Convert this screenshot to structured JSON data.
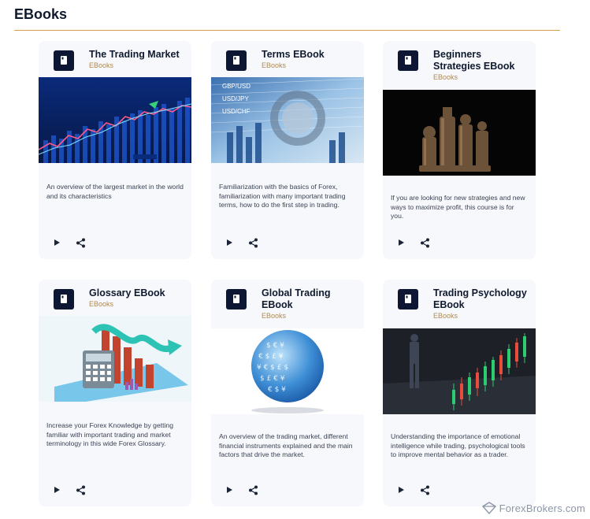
{
  "page": {
    "title": "EBooks"
  },
  "cards": [
    {
      "title": "The Trading Market",
      "category": "EBooks",
      "description": "An overview of the largest market in the world and its characteristics",
      "image": "rising-chart-image"
    },
    {
      "title": "Terms EBook",
      "category": "EBooks",
      "description": "Familiarization with the basics of Forex, familiarization with many important trading terms, how to do the first step in trading.",
      "image": "forex-terms-image"
    },
    {
      "title": "Beginners Strategies EBook",
      "category": "EBooks",
      "description": "If you are looking for new strategies and new ways to maximize profit, this course is for you.",
      "image": "chess-pieces-image"
    },
    {
      "title": "Glossary EBook",
      "category": "EBooks",
      "description": "Increase your Forex Knowledge by getting familiar with important trading and market terminology in this wide Forex Glossary.",
      "image": "calculator-chart-image"
    },
    {
      "title": "Global Trading EBook",
      "category": "EBooks",
      "description": "An overview of the trading market, different financial instruments explained and the main factors that drive the market.",
      "image": "currency-globe-image"
    },
    {
      "title": "Trading Psychology EBook",
      "category": "EBooks",
      "description": "Understanding the importance of emotional intelligence while trading, psychological tools to improve mental behavior as a trader.",
      "image": "trader-candles-image"
    }
  ],
  "watermark": {
    "text": "ForexBrokers.com"
  },
  "icons": {
    "card": "book-icon",
    "play": "play-icon",
    "share": "share-icon",
    "watermark": "forexbrokers-logo-icon"
  },
  "colors": {
    "accent": "#d4a04c",
    "icon_bg": "#0d1633",
    "card_bg": "#f7f8fc",
    "category": "#b0894a"
  }
}
